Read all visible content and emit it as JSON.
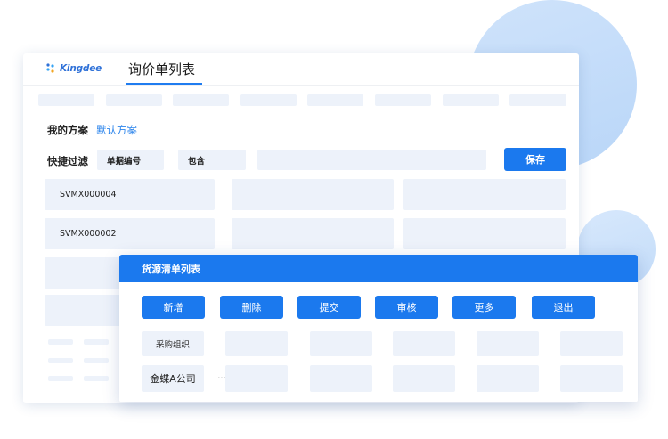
{
  "app": {
    "brand": "Kingdee",
    "title": "询价单列表"
  },
  "filters": {
    "my_scheme_label": "我的方案",
    "default_scheme_link": "默认方案",
    "quick_filter_label": "快捷过滤",
    "field_name": "单据编号",
    "operator": "包含",
    "value": "",
    "save_label": "保存"
  },
  "list": {
    "rows": [
      {
        "code": "SVMX000004"
      },
      {
        "code": "SVMX000002"
      }
    ]
  },
  "dialog": {
    "title": "货源清单列表",
    "buttons": [
      "新增",
      "删除",
      "提交",
      "审核",
      "更多",
      "退出"
    ],
    "column_header": "采购组织",
    "row_value": "金蝶A公司",
    "row_ellipsis": "···"
  },
  "colors": {
    "accent": "#1b79ee",
    "link": "#2e86ec",
    "placeholder": "#edf2fa"
  }
}
